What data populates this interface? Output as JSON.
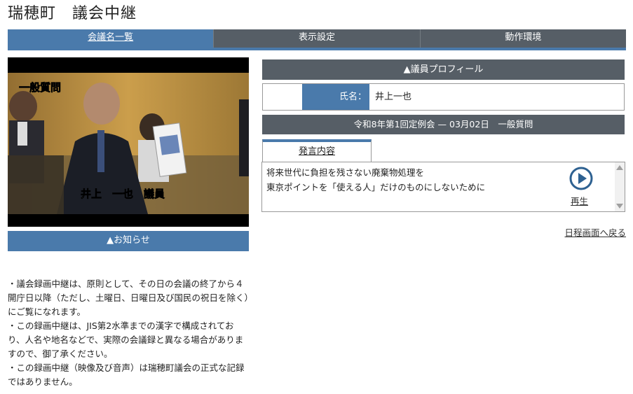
{
  "header": {
    "title": "瑞穂町　議会中継"
  },
  "nav": {
    "tabs": [
      {
        "label": "会議名一覧",
        "active": true
      },
      {
        "label": "表示設定",
        "active": false
      },
      {
        "label": "動作環境",
        "active": false
      }
    ]
  },
  "video": {
    "caption_top": "一般質問",
    "caption_name": "井上　一也　議員"
  },
  "notice": {
    "bar_label": "▲お知らせ",
    "paragraphs": [
      "・議会録画中継は、原則として、その日の会議の終了から４開庁日以降（ただし、土曜日、日曜日及び国民の祝日を除く）にご覧になれます。",
      "・この録画中継は、JIS第2水準までの漢字で構成されており、人名や地名などで、実際の会議録と異なる場合がありますので、御了承ください。",
      "・この録画中継（映像及び音声）は瑞穂町議会の正式な記録ではありません。"
    ]
  },
  "profile": {
    "bar_label": "▲議員プロフィール",
    "name_label": "氏名：",
    "name_value": "井上一也"
  },
  "meeting": {
    "title": "令和8年第1回定例会 — 03月02日　一般質問"
  },
  "speech": {
    "tab_label": "発言内容",
    "lines": [
      "将来世代に負担を残さない廃棄物処理を",
      "東京ポイントを「使える人」だけのものにしないために"
    ],
    "play_label": "再生"
  },
  "back_link": "日程画面へ戻る",
  "colors": {
    "accent": "#4a7aab",
    "dark_bar": "#565e66"
  }
}
